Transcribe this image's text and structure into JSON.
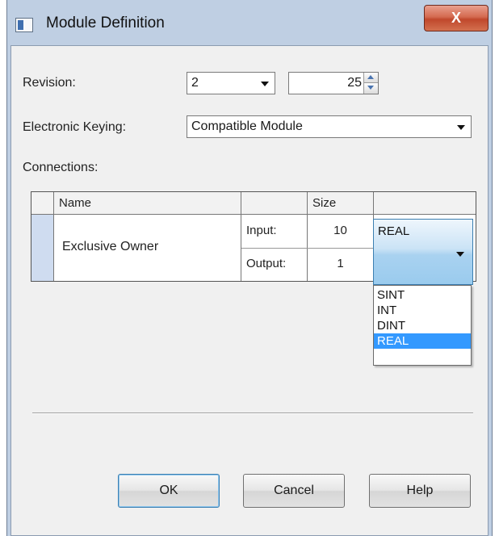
{
  "window": {
    "title": "Module Definition",
    "close_label": "X",
    "icon": "window-app-icon"
  },
  "form": {
    "revision_label": "Revision:",
    "revision_major": "2",
    "revision_minor": "25",
    "keying_label": "Electronic Keying:",
    "keying_value": "Compatible Module",
    "connections_label": "Connections:"
  },
  "grid": {
    "headers": [
      "Name",
      "",
      "Size",
      ""
    ],
    "row": {
      "name": "Exclusive Owner",
      "input_label": "Input:",
      "input_size": "10",
      "output_label": "Output:",
      "output_size": "1",
      "data_type": "REAL"
    }
  },
  "data_type_dropdown": {
    "options": [
      "SINT",
      "INT",
      "DINT",
      "REAL"
    ],
    "selected": "REAL"
  },
  "buttons": {
    "ok": "OK",
    "cancel": "Cancel",
    "help": "Help"
  },
  "colors": {
    "selection": "#3399ff",
    "close_button": "#c0482c",
    "frame": "#bfcfe3"
  }
}
